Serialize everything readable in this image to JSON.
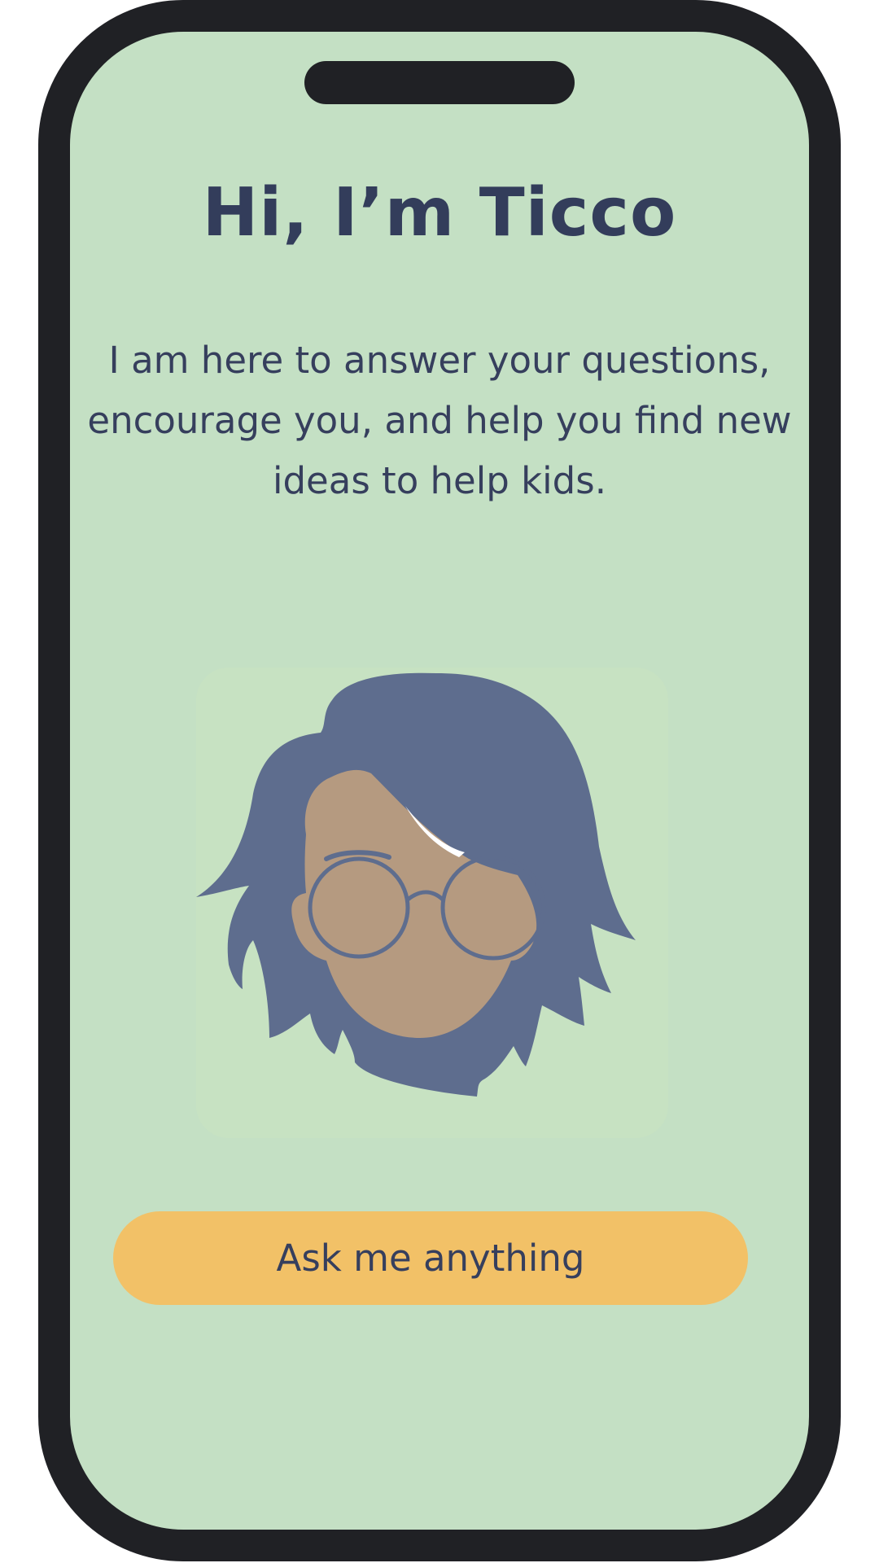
{
  "screen": {
    "title": "Hi, I’m Ticco",
    "intro": "I am here to answer your questions, encourage you, and help you find new ideas to help kids.",
    "cta_label": "Ask me anything"
  },
  "colors": {
    "background": "#c4e0c4",
    "device_frame": "#202125",
    "text": "#333d5b",
    "button": "#f2c167",
    "avatar_hair": "#5e6d8e",
    "avatar_skin": "#b59a80"
  },
  "icons": {
    "avatar": "ticco-avatar-icon"
  }
}
